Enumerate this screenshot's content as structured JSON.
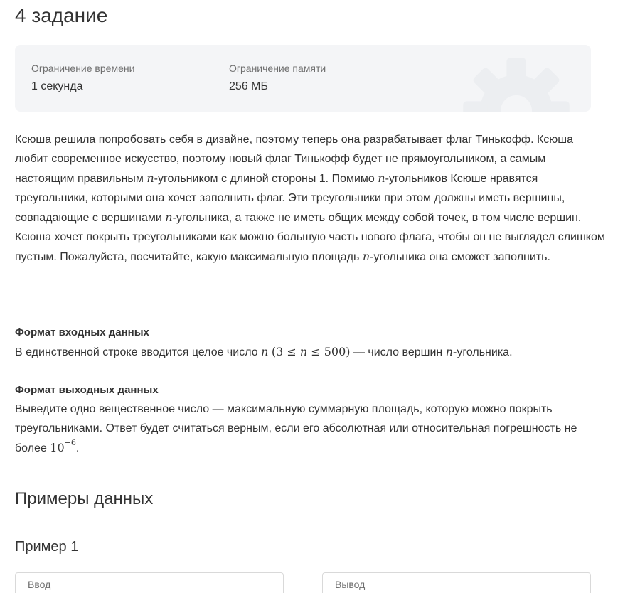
{
  "task": {
    "title": "4 задание"
  },
  "limits": {
    "time_label": "Ограничение времени",
    "time_value": "1 секунда",
    "memory_label": "Ограничение памяти",
    "memory_value": "256 МБ"
  },
  "statement": {
    "p1_a": "Ксюша решила попробовать себя в дизайне, поэтому теперь она разрабатывает флаг Тинькофф. Ксюша любит современное искусство, поэтому новый флаг Тинькофф будет не прямоугольником, а самым настоящим правильным ",
    "var_n": "n",
    "p1_b": "-угольником с длиной стороны 1. Помимо ",
    "p1_c": "-угольников Ксюше нравятся треугольники, которыми она хочет заполнить флаг. Эти треугольники при этом должны иметь вершины, совпадающие с вершинами ",
    "p1_d": "-угольника, а также не иметь общих между собой точек, в том числе вершин.",
    "p2_a": "Ксюша хочет покрыть треугольниками как можно большую часть нового флага, чтобы он не выглядел слишком пустым. Пожалуйста, посчитайте, какую максимальную площадь ",
    "p2_b": "-угольника она сможет заполнить."
  },
  "input_format": {
    "heading": "Формат входных данных",
    "text_a": "В единственной строке вводится целое число ",
    "constraint_open": "(3 ≤ ",
    "constraint_close": " ≤ 500)",
    "text_b": " — число вершин ",
    "text_c": "-угольника."
  },
  "output_format": {
    "heading": "Формат выходных данных",
    "text_a": "Выведите одно вещественное число — максимальную суммарную площадь, которую можно покрыть треугольниками. Ответ будет считаться верным, если его абсолютная или относительная погрешность не более ",
    "base": "10",
    "exponent": "−6",
    "text_b": "."
  },
  "examples": {
    "title": "Примеры данных",
    "example1_title": "Пример 1",
    "input_label": "Ввод",
    "output_label": "Вывод"
  },
  "icons": {
    "background_icon": "gear-icon",
    "gear_color": "#eceef1"
  }
}
